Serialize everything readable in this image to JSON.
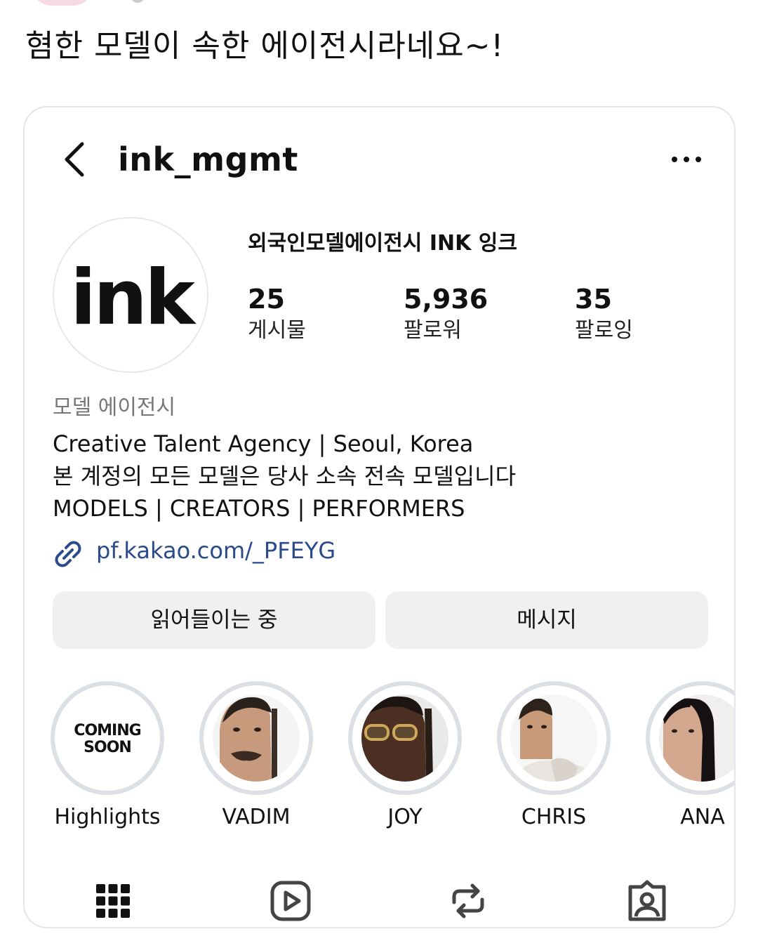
{
  "tweet": {
    "text": "혐한 모델이 속한 에이전시라네요~!"
  },
  "profile": {
    "username": "ink_mgmt",
    "display_name": "외국인모델에이전시 INK 잉크",
    "logo_text": "ink",
    "stats": [
      {
        "value": "25",
        "label": "게시물"
      },
      {
        "value": "5,936",
        "label": "팔로워"
      },
      {
        "value": "35",
        "label": "팔로잉"
      }
    ],
    "category": "모델 에이전시",
    "bio": [
      "Creative Talent Agency | Seoul, Korea",
      "본 계정의 모든 모델은 당사 소속 전속 모델입니다",
      "MODELS | CREATORS | PERFORMERS"
    ],
    "link": "pf.kakao.com/_PFEYG"
  },
  "buttons": {
    "follow": "읽어들이는 중",
    "message": "메시지"
  },
  "highlights": [
    {
      "label": "Highlights",
      "cover_text": "COMING SOON"
    },
    {
      "label": "VADIM"
    },
    {
      "label": "JOY"
    },
    {
      "label": "CHRIS"
    },
    {
      "label": "ANA"
    }
  ],
  "tabs": [
    "grid-icon",
    "reels-icon",
    "reposts-icon",
    "tagged-icon"
  ],
  "colors": {
    "link": "#2a4a8c",
    "button_bg": "#eff0f2",
    "ring": "#dcdfe3",
    "category": "#777777"
  }
}
